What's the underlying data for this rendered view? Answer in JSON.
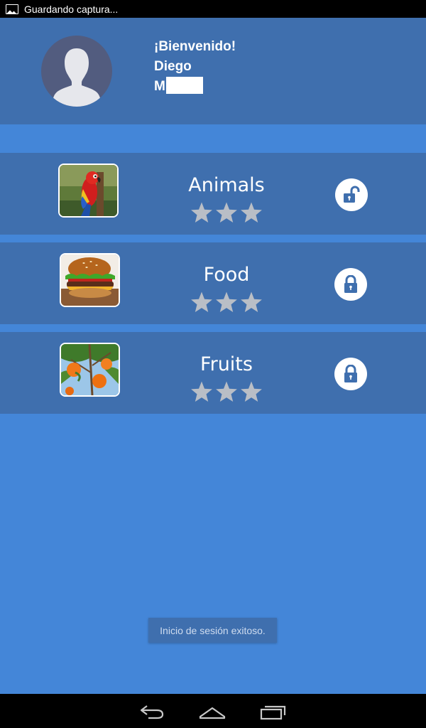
{
  "status_bar": {
    "notification_icon": "image-icon",
    "text": "Guardando captura..."
  },
  "header": {
    "avatar_icon": "person-silhouette-icon",
    "greeting": "¡Bienvenido!",
    "first_name": "Diego",
    "last_name_visible": "M",
    "last_name_redacted": true
  },
  "categories": [
    {
      "name": "Animals",
      "image": "parrot",
      "stars_earned": 0,
      "stars_total": 3,
      "lock": "unlocked",
      "lock_icon": "unlocked-padlock-icon"
    },
    {
      "name": "Food",
      "image": "burger",
      "stars_earned": 0,
      "stars_total": 3,
      "lock": "locked",
      "lock_icon": "locked-padlock-icon"
    },
    {
      "name": "Fruits",
      "image": "oranges",
      "stars_earned": 0,
      "stars_total": 3,
      "lock": "locked",
      "lock_icon": "locked-padlock-icon"
    }
  ],
  "toast": {
    "message": "Inicio de sesión exitoso."
  },
  "nav_bar": {
    "back_icon": "back-icon",
    "home_icon": "home-icon",
    "recents_icon": "recent-apps-icon"
  },
  "colors": {
    "background": "#4486d8",
    "panel": "#3f6fae",
    "star_empty": "#b9bec6",
    "accent": "#3f6fae"
  }
}
